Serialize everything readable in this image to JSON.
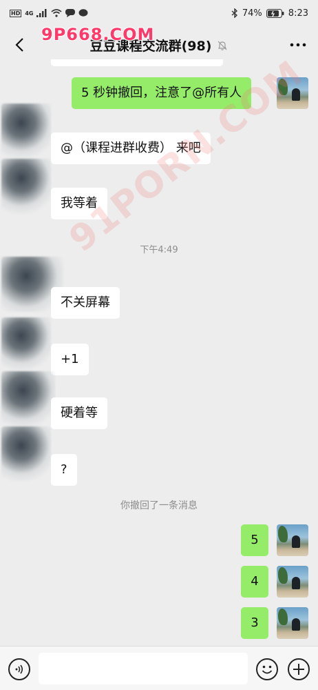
{
  "status_bar": {
    "hd": "HD",
    "network": "4G",
    "battery": "74%",
    "time": "8:23"
  },
  "watermark": {
    "top": "9P668.COM",
    "diagonal": "91PORN.COM"
  },
  "header": {
    "title": "豆豆课程交流群(98)",
    "muted": true
  },
  "messages": [
    {
      "side": "out",
      "text": "5 秒钟撤回，注意了@所有人"
    },
    {
      "side": "in",
      "text": "@（课程进群收费） 来吧"
    },
    {
      "side": "in",
      "text": "我等着"
    },
    {
      "side": "in",
      "text": "不关屏幕"
    },
    {
      "side": "in",
      "text": "+1"
    },
    {
      "side": "in",
      "text": "硬着等"
    },
    {
      "side": "in",
      "text": "?"
    },
    {
      "side": "out",
      "text": "5"
    },
    {
      "side": "out",
      "text": "4"
    },
    {
      "side": "out",
      "text": "3"
    }
  ],
  "timestamps": {
    "t1": "下午4:49"
  },
  "system_notice": "你撤回了一条消息",
  "input": {
    "value": "",
    "placeholder": ""
  },
  "colors": {
    "background": "#ededed",
    "outgoing_bubble": "#95ec69",
    "incoming_bubble": "#ffffff",
    "watermark": "#ff3a6a"
  },
  "icons": {
    "back": "chevron-left-icon",
    "mute": "bell-off-icon",
    "more": "more-dots-icon",
    "voice": "voice-icon",
    "emoji": "emoji-icon",
    "plus": "plus-icon"
  }
}
